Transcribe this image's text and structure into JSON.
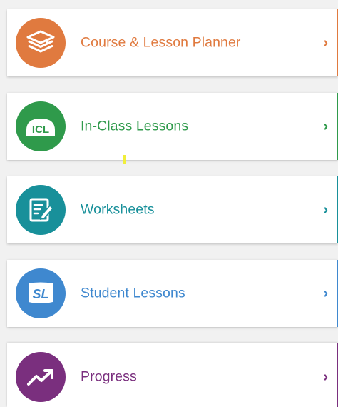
{
  "menu": {
    "items": [
      {
        "label": "Course & Lesson Planner",
        "icon": "stacked-books-icon",
        "color": "#e07a3f"
      },
      {
        "label": "In-Class Lessons",
        "icon": "icl-badge-icon",
        "abbr": "ICL",
        "color": "#2f9a4b"
      },
      {
        "label": "Worksheets",
        "icon": "worksheet-edit-icon",
        "color": "#18909a"
      },
      {
        "label": "Student Lessons",
        "icon": "sl-badge-icon",
        "abbr": "SL",
        "color": "#3f88cf"
      },
      {
        "label": "Progress",
        "icon": "trend-up-icon",
        "color": "#7a2f7e"
      }
    ],
    "chevron": "›"
  }
}
